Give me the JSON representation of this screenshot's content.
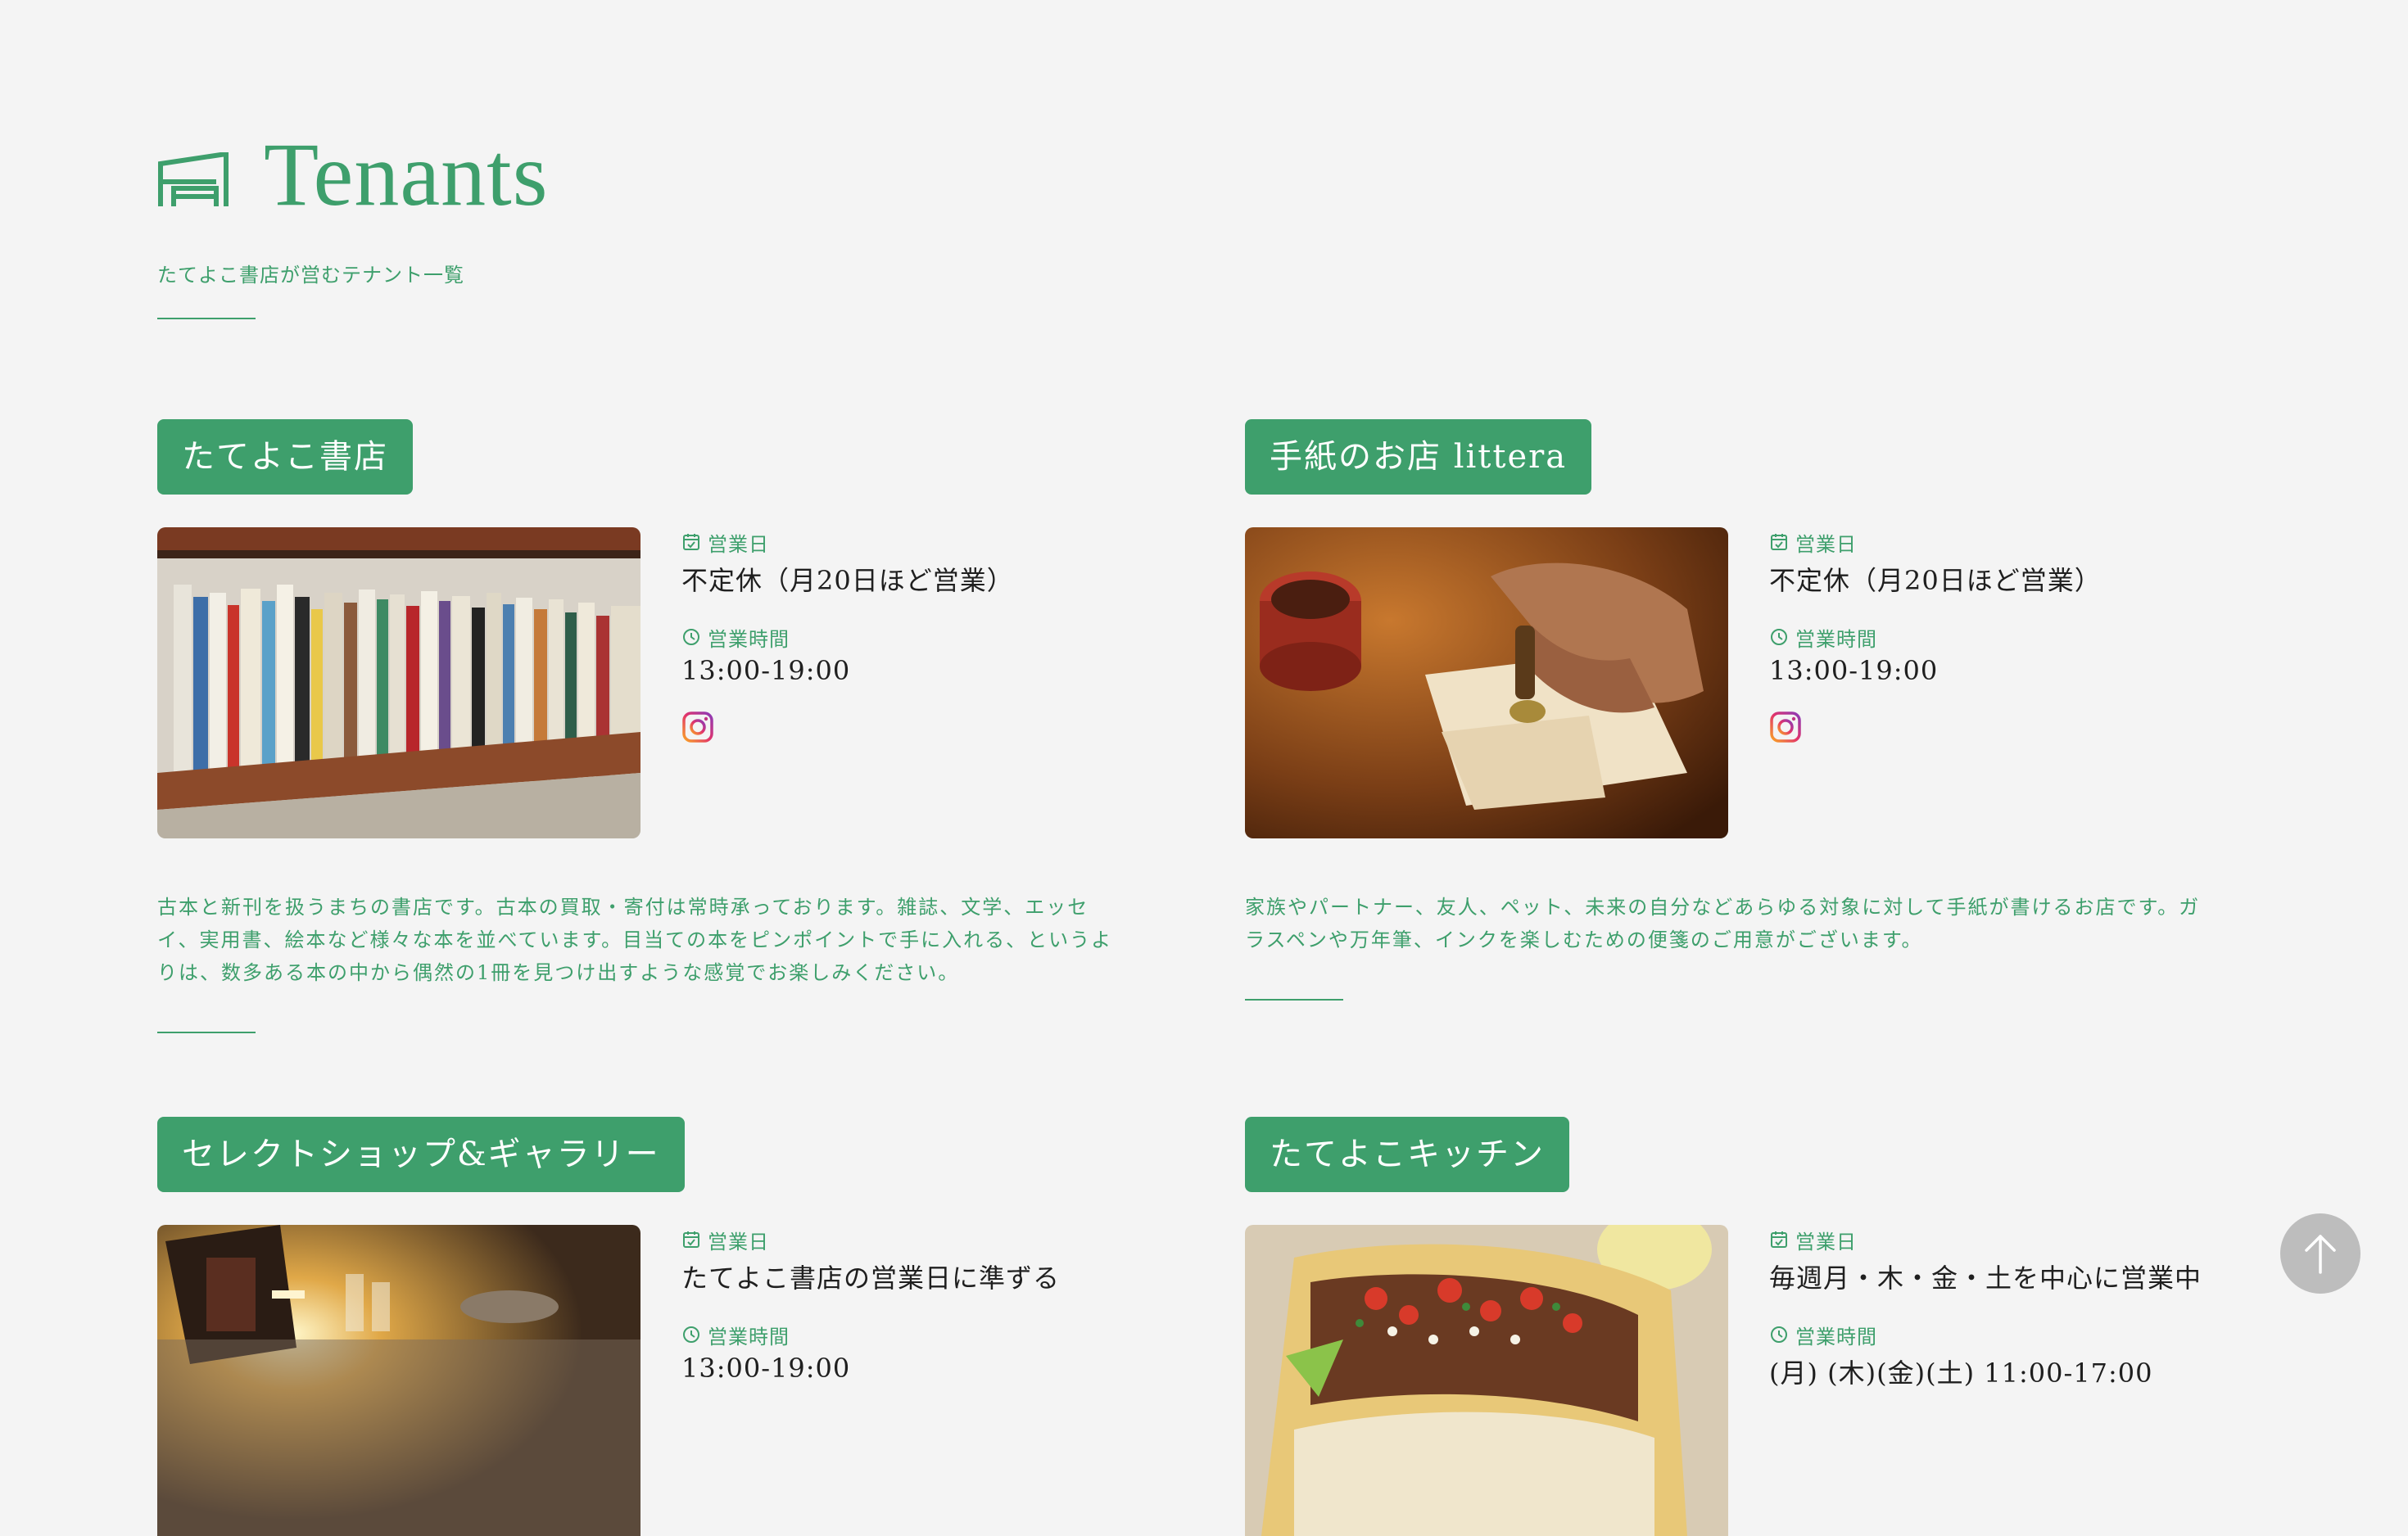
{
  "header": {
    "title": "Tenants",
    "subtitle": "たてよこ書店が営むテナント一覧",
    "icon": "storefront-icon"
  },
  "labels": {
    "business_days": "営業日",
    "business_hours": "営業時間"
  },
  "tenants": [
    {
      "name": "たてよこ書店",
      "business_days": "不定休（月20日ほど営業）",
      "business_hours": "13:00-19:00",
      "description": "古本と新刊を扱うまちの書店です。古本の買取・寄付は常時承っております。雑誌、文学、エッセイ、実用書、絵本など様々な本を並べています。目当ての本をピンポイントで手に入れる、というよりは、数多ある本の中から偶然の1冊を見つけ出すような感覚でお楽しみください。"
    },
    {
      "name": "手紙のお店 littera",
      "business_days": "不定休（月20日ほど営業）",
      "business_hours": "13:00-19:00",
      "description": "家族やパートナー、友人、ペット、未来の自分などあらゆる対象に対して手紙が書けるお店です。ガラスペンや万年筆、インクを楽しむための便箋のご用意がございます。"
    },
    {
      "name": "セレクトショップ&ギャラリー",
      "business_days": "たてよこ書店の営業日に準ずる",
      "business_hours": "13:00-19:00"
    },
    {
      "name": "たてよこキッチン",
      "business_days": "毎週月・木・金・土を中心に営業中",
      "business_hours": "(月) (木)(金)(土) 11:00-17:00"
    }
  ],
  "colors": {
    "accent": "#3e9f6c",
    "background": "#f4f4f4",
    "text": "#1f1f1f",
    "scroll_top_button": "#bdbdbd"
  },
  "icons": {
    "calendar": "calendar-icon",
    "clock": "clock-icon",
    "instagram": "instagram-icon",
    "scroll_top": "arrow-up-icon"
  }
}
